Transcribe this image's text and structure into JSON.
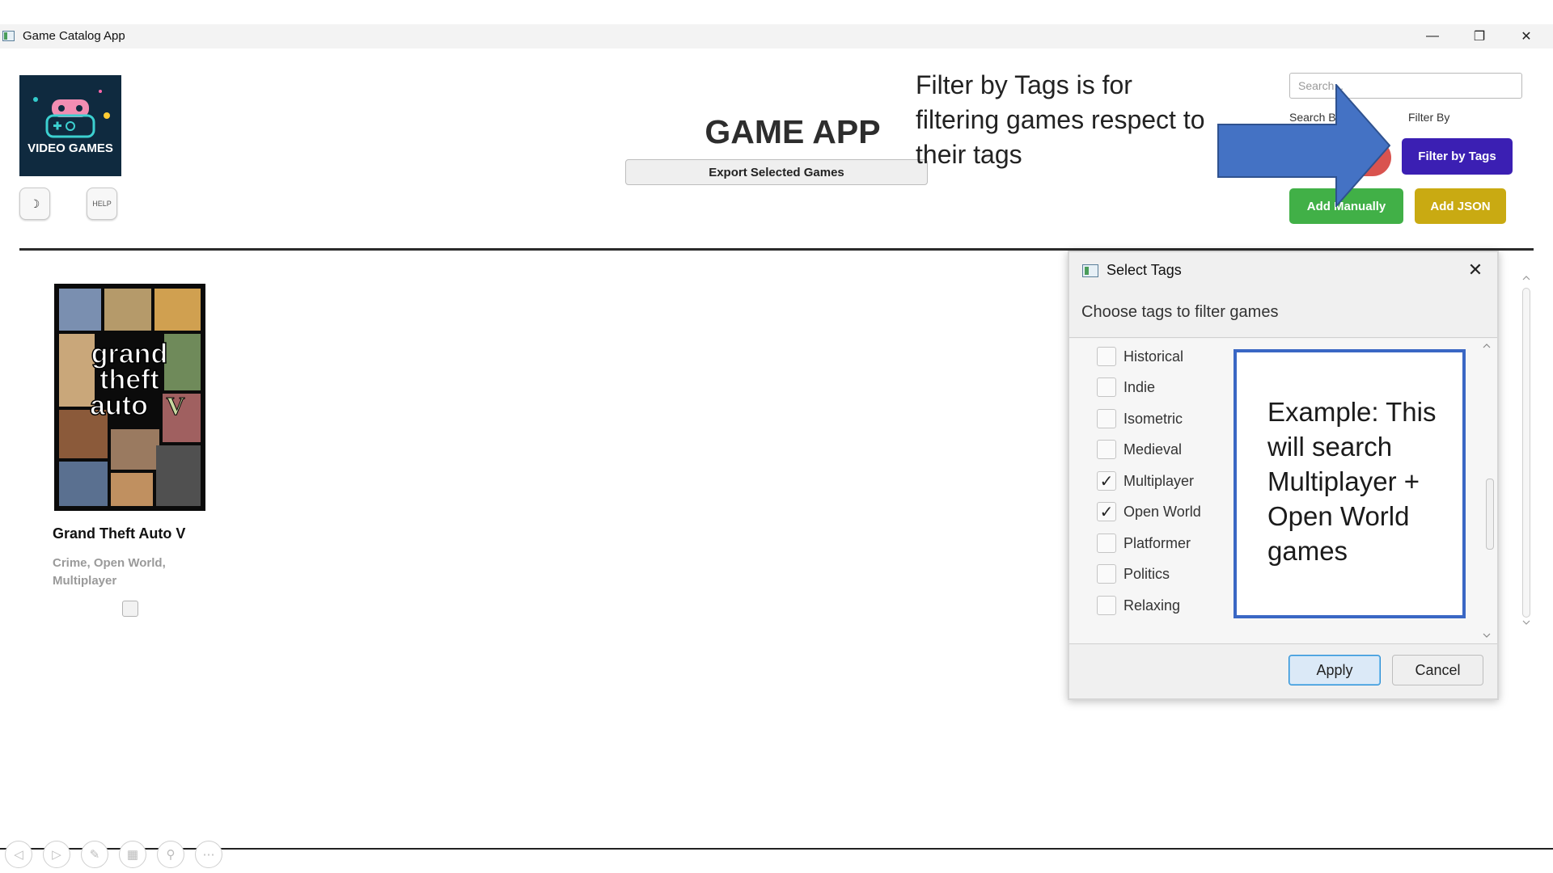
{
  "window": {
    "title": "Game Catalog App",
    "controls": {
      "minimize": "—",
      "restore": "❐",
      "close": "✕"
    }
  },
  "header": {
    "logo_text": "VIDEO GAMES",
    "theme_toggle_icon": "☽",
    "help_label": "HELP",
    "app_title": "GAME APP",
    "export_label": "Export Selected Games",
    "annotation": "Filter by Tags is for filtering games respect to their tags",
    "search_placeholder": "Search...",
    "search_by_label": "Search B",
    "filter_by_label": "Filter By",
    "filter_tags_label": "Filter by Tags",
    "add_manually_label": "Add Manually",
    "add_json_label": "Add JSON"
  },
  "games": [
    {
      "title": "Grand Theft Auto V",
      "tags_line1": "Crime, Open World,",
      "tags_line2": "Multiplayer",
      "selected": false
    }
  ],
  "dialog": {
    "title": "Select Tags",
    "subtitle": "Choose tags to filter games",
    "tags": [
      {
        "label": "Historical",
        "checked": false
      },
      {
        "label": "Indie",
        "checked": false
      },
      {
        "label": "Isometric",
        "checked": false
      },
      {
        "label": "Medieval",
        "checked": false
      },
      {
        "label": "Multiplayer",
        "checked": true
      },
      {
        "label": "Open World",
        "checked": true
      },
      {
        "label": "Platformer",
        "checked": false
      },
      {
        "label": "Politics",
        "checked": false
      },
      {
        "label": "Relaxing",
        "checked": false
      }
    ],
    "example_note": "Example: This will search Multiplayer + Open World games",
    "apply_label": "Apply",
    "cancel_label": "Cancel"
  },
  "colors": {
    "filter_button": "#3b1fb3",
    "add_manually": "#41b047",
    "add_json": "#c9aa12",
    "annotation_arrow": "#4472c4",
    "example_border": "#3a67c4"
  }
}
